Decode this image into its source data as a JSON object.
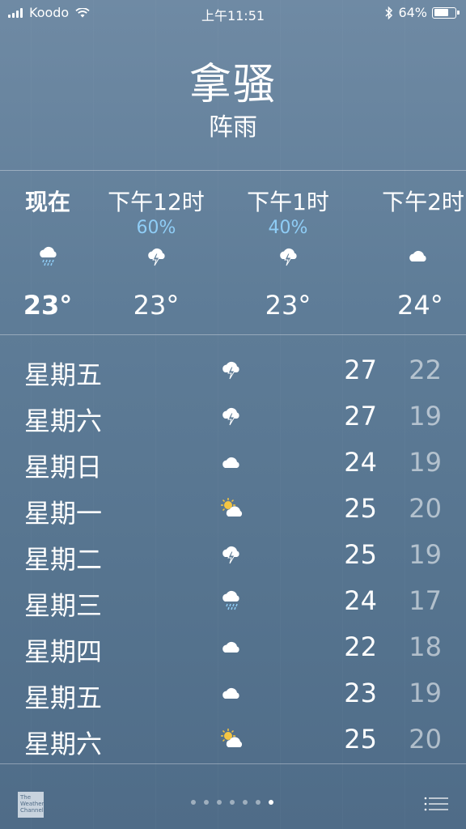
{
  "status": {
    "carrier": "Koodo",
    "time": "上午11:51",
    "battery": "64%",
    "battery_fraction": 0.64
  },
  "header": {
    "city": "拿骚",
    "condition": "阵雨"
  },
  "hourly": [
    {
      "label": "现在",
      "pct": "",
      "icon": "rain-cloud-icon",
      "temp": "23°"
    },
    {
      "label": "下午12时",
      "pct": "60%",
      "icon": "thunder-cloud-icon",
      "temp": "23°"
    },
    {
      "label": "下午1时",
      "pct": "40%",
      "icon": "thunder-cloud-icon",
      "temp": "23°"
    },
    {
      "label": "下午2时",
      "pct": "",
      "icon": "cloud-icon",
      "temp": "24°"
    }
  ],
  "daily": [
    {
      "day": "星期五",
      "icon": "thunder-cloud-icon",
      "hi": "27",
      "lo": "22"
    },
    {
      "day": "星期六",
      "icon": "thunder-cloud-icon",
      "hi": "27",
      "lo": "19"
    },
    {
      "day": "星期日",
      "icon": "cloud-icon",
      "hi": "24",
      "lo": "19"
    },
    {
      "day": "星期一",
      "icon": "partly-sunny-icon",
      "hi": "25",
      "lo": "20"
    },
    {
      "day": "星期二",
      "icon": "thunder-cloud-icon",
      "hi": "25",
      "lo": "19"
    },
    {
      "day": "星期三",
      "icon": "rain-cloud-icon",
      "hi": "24",
      "lo": "17"
    },
    {
      "day": "星期四",
      "icon": "cloud-icon",
      "hi": "22",
      "lo": "18"
    },
    {
      "day": "星期五",
      "icon": "cloud-icon",
      "hi": "23",
      "lo": "19"
    },
    {
      "day": "星期六",
      "icon": "partly-sunny-icon",
      "hi": "25",
      "lo": "20"
    }
  ],
  "footer": {
    "logo_text": "The Weather Channel",
    "page_count": 7,
    "active_page": 7
  },
  "colors": {
    "precip": "#8fcdf6",
    "sun": "#f4c542"
  }
}
